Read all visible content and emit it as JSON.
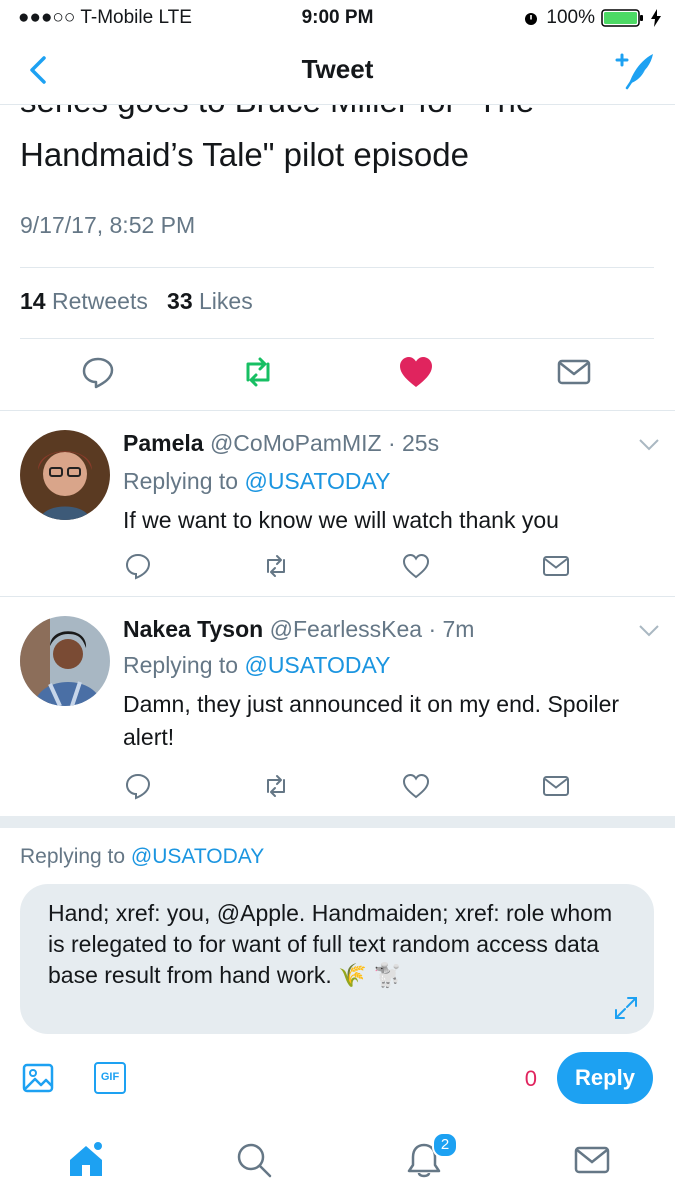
{
  "status_bar": {
    "carrier": "●●●○○ T-Mobile  LTE",
    "time": "9:00 PM",
    "battery": "100%"
  },
  "nav": {
    "title": "Tweet",
    "back_icon": "chevron-left-icon",
    "compose_icon": "compose-tweet-icon"
  },
  "tweet": {
    "text_line1": "series goes to Bruce Miller for \"The",
    "text_line2": "Handmaid’s Tale\" pilot episode",
    "timestamp": "9/17/17, 8:52 PM",
    "retweets": "14",
    "retweets_label": "Retweets",
    "likes": "33",
    "likes_label": "Likes",
    "colors": {
      "retweet": "#17bf63",
      "like": "#e0245e"
    }
  },
  "replies": [
    {
      "name": "Pamela",
      "handle": "@CoMoPamMIZ",
      "time": "· 25s",
      "replying_prefix": "Replying to",
      "replying_to": "@USATODAY",
      "text": "If we want to know we will watch thank you"
    },
    {
      "name": "Nakea Tyson",
      "handle": "@FearlessKea",
      "time": "· 7m",
      "replying_prefix": "Replying to",
      "replying_to": "@USATODAY",
      "text": "Damn, they just announced it on my end. Spoiler alert!"
    }
  ],
  "composer": {
    "replying_prefix": "Replying to",
    "replying_to": "@USATODAY",
    "text": "Hand; xref: you, @Apple. Handmaiden; xref: role whom is relegated to for want of full text random access data base result from hand work. 🌾 🐩",
    "char_count": "0",
    "reply_button": "Reply",
    "gif_label": "GIF"
  },
  "tabbar": {
    "notifications_badge": "2"
  }
}
